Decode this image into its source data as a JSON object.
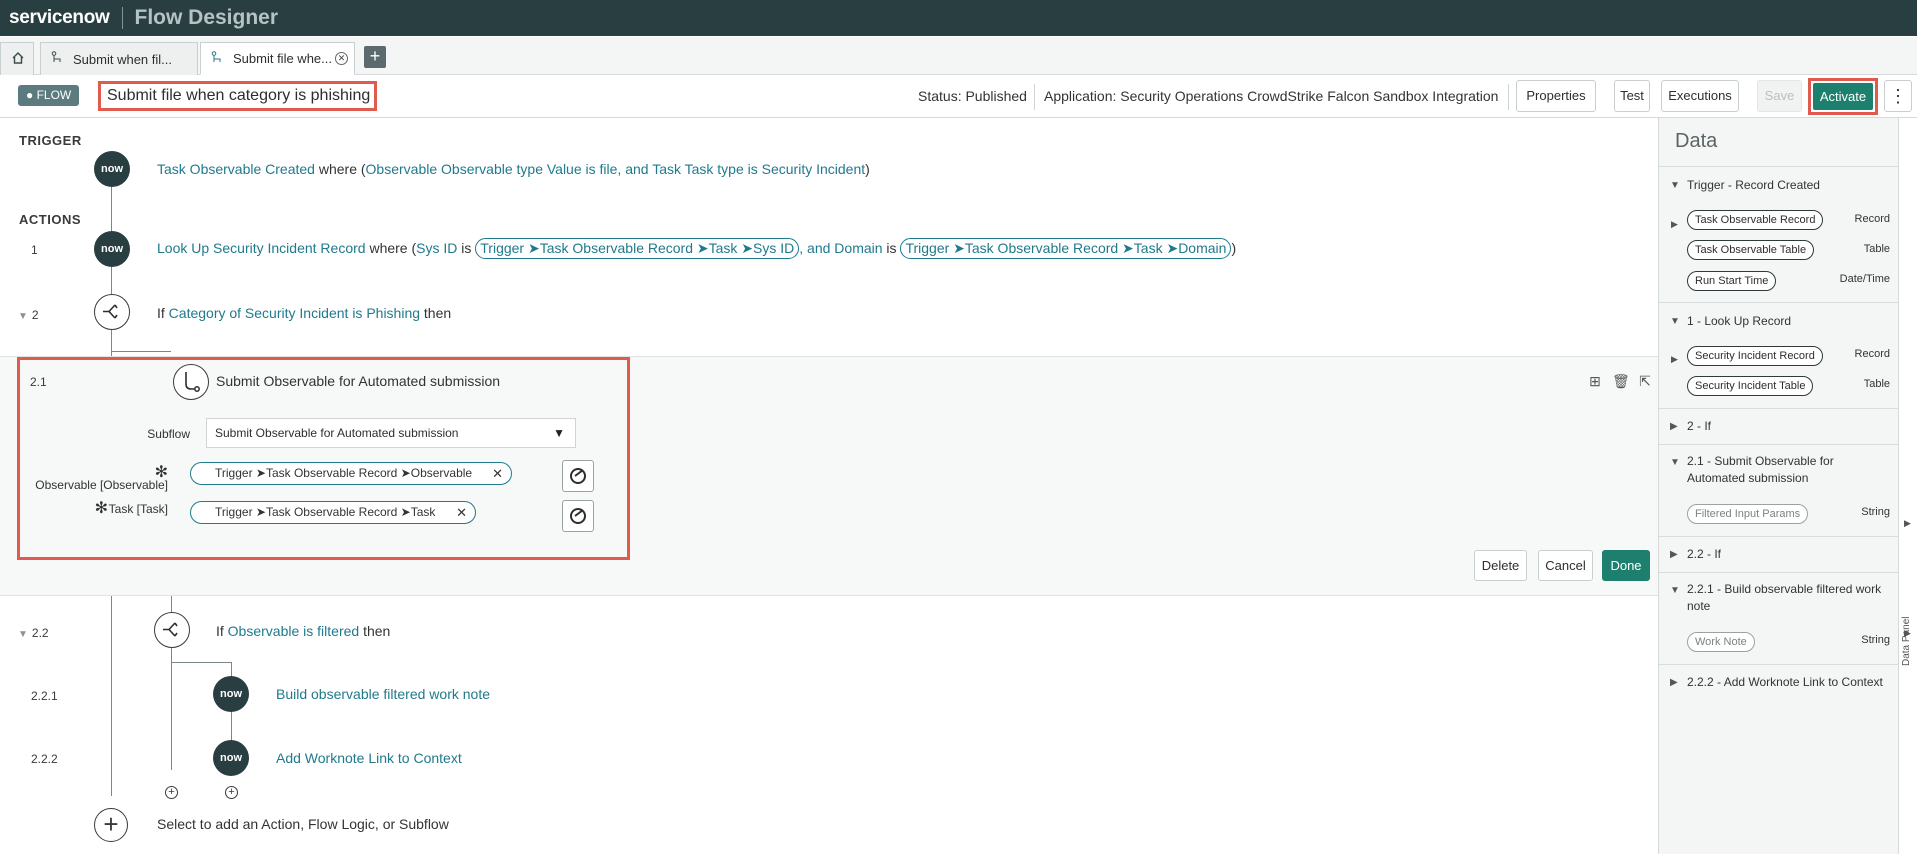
{
  "app": {
    "brand": "servicenow",
    "name": "Flow Designer"
  },
  "tabs": [
    {
      "label": "Submit when fil..."
    },
    {
      "label": "Submit file whe..."
    }
  ],
  "flow": {
    "badge": "FLOW",
    "title": "Submit file when category is phishing",
    "status": "Status: Published",
    "application": "Application: Security Operations CrowdStrike Falcon Sandbox Integration"
  },
  "toolbar": {
    "properties": "Properties",
    "test": "Test",
    "executions": "Executions",
    "save": "Save",
    "activate": "Activate"
  },
  "trigger": {
    "section_label": "TRIGGER",
    "name": "Task Observable Created",
    "where": " where (",
    "condition": "Observable Observable type Value is file, and Task Task type is Security Incident",
    "close": ")"
  },
  "actions": {
    "section_label": "ACTIONS",
    "step1": {
      "num": "1",
      "name": "Look Up Security Incident Record",
      "where": " where (",
      "sysid_label": "Sys ID",
      "is1": " is ",
      "pill1": "Trigger ➤Task Observable Record ➤Task ➤Sys ID",
      "and_domain": ", and Domain",
      "is2": " is ",
      "pill2": "Trigger ➤Task Observable Record ➤Task ➤Domain",
      "close": ")"
    },
    "step2": {
      "num": "2",
      "if": "If ",
      "condition": "Category of Security Incident is Phishing",
      "then": " then"
    },
    "step21": {
      "num": "2.1",
      "title": "Submit Observable for Automated submission",
      "subflow_label": "Subflow",
      "subflow_value": "Submit Observable for Automated submission",
      "observable_label": "Observable [Observable]",
      "observable_value": "Trigger ➤Task Observable Record ➤Observable",
      "task_label": "Task [Task]",
      "task_value": "Trigger ➤Task Observable Record ➤Task",
      "delete": "Delete",
      "cancel": "Cancel",
      "done": "Done"
    },
    "step22": {
      "num": "2.2",
      "if": "If ",
      "condition": "Observable is filtered",
      "then": " then"
    },
    "step221": {
      "num": "2.2.1",
      "name": "Build observable filtered work note"
    },
    "step222": {
      "num": "2.2.2",
      "name": "Add Worknote Link to Context"
    },
    "add_prompt": "Select to add an Action, Flow Logic, or Subflow"
  },
  "data_panel": {
    "title": "Data",
    "rail_label": "Data Panel",
    "sections": [
      {
        "label": "Trigger - Record Created",
        "items": [
          {
            "pill": "Task Observable Record",
            "type": "Record"
          },
          {
            "pill": "Task Observable Table",
            "type": "Table"
          },
          {
            "pill": "Run Start Time",
            "type": "Date/Time"
          }
        ]
      },
      {
        "label": "1 - Look Up Record",
        "items": [
          {
            "pill": "Security Incident Record",
            "type": "Record"
          },
          {
            "pill": "Security Incident Table",
            "type": "Table"
          }
        ]
      },
      {
        "label": "2 - If"
      },
      {
        "label": "2.1 - Submit Observable for Automated submission",
        "items": [
          {
            "pill": "Filtered Input Params",
            "type": "String"
          }
        ]
      },
      {
        "label": "2.2 - If"
      },
      {
        "label": "2.2.1 - Build observable filtered work note",
        "items": [
          {
            "pill": "Work Note",
            "type": "String"
          }
        ]
      },
      {
        "label": "2.2.2 - Add Worknote Link to Context"
      }
    ]
  },
  "icons": {
    "now": "now",
    "home": "home-icon",
    "flow": "flow-icon"
  },
  "colors": {
    "header": "#293e40",
    "accent": "#1d7f6e",
    "link": "#1f7a8c",
    "highlight": "#e05a4d"
  }
}
